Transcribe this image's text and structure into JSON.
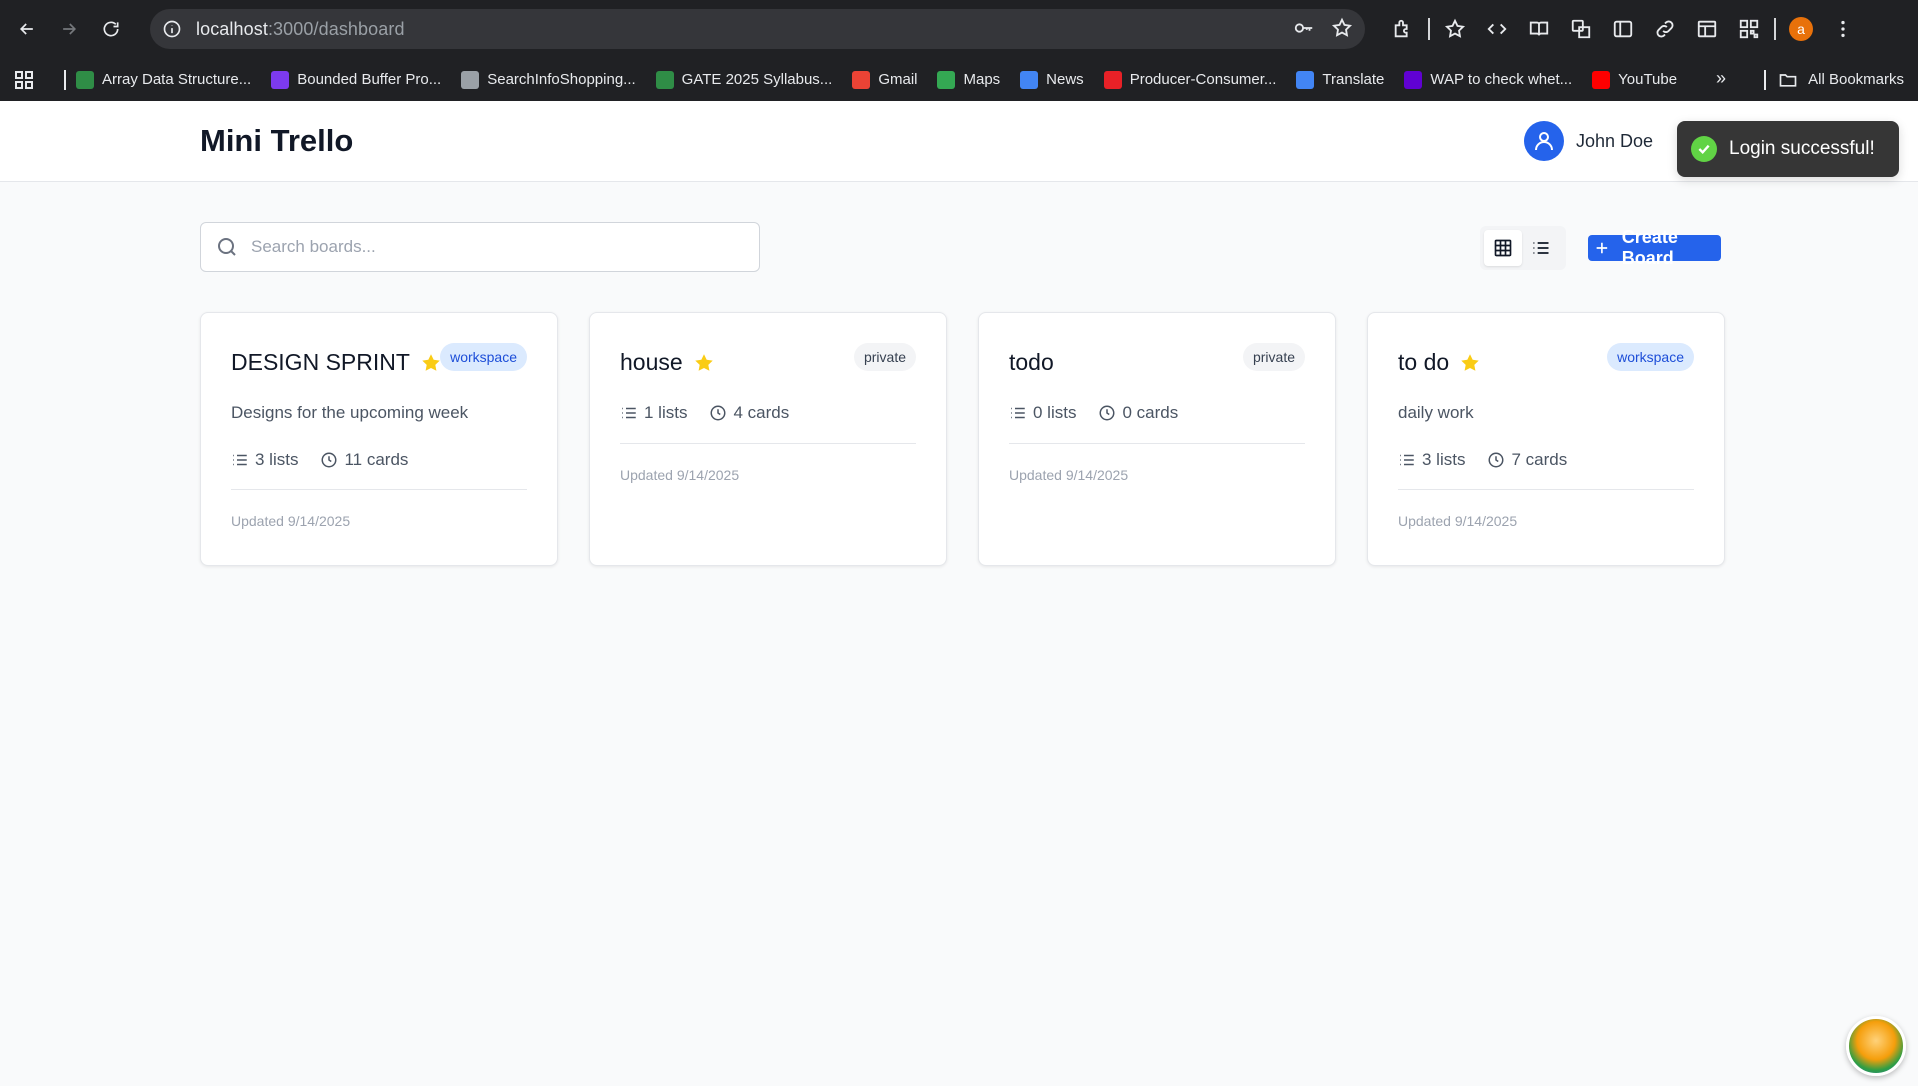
{
  "browser": {
    "url_host": "localhost",
    "url_path": ":3000/dashboard",
    "profile_initial": "a",
    "bookmarks": [
      {
        "label": "Array Data Structure...",
        "icon": "gfg-icon",
        "color": "#2f8d46"
      },
      {
        "label": "Bounded Buffer Pro...",
        "icon": "studytonight-icon",
        "color": "#7c3aed"
      },
      {
        "label": "SearchInfoShopping...",
        "icon": "globe-icon",
        "color": "#9aa0a6"
      },
      {
        "label": "GATE 2025 Syllabus...",
        "icon": "gfg-icon",
        "color": "#2f8d46"
      },
      {
        "label": "Gmail",
        "icon": "gmail-icon",
        "color": "#ea4335"
      },
      {
        "label": "Maps",
        "icon": "maps-icon",
        "color": "#34a853"
      },
      {
        "label": "News",
        "icon": "news-icon",
        "color": "#4285f4"
      },
      {
        "label": "Producer-Consumer...",
        "icon": "tesla-icon",
        "color": "#e82127"
      },
      {
        "label": "Translate",
        "icon": "translate-icon",
        "color": "#4285f4"
      },
      {
        "label": "WAP to check whet...",
        "icon": "yahoo-icon",
        "color": "#6001d2"
      },
      {
        "label": "YouTube",
        "icon": "youtube-icon",
        "color": "#ff0000"
      }
    ],
    "all_bookmarks": "All Bookmarks"
  },
  "app": {
    "title": "Mini Trello",
    "user_name": "John Doe",
    "toast": "Login successful!",
    "search_placeholder": "Search boards...",
    "create_board": "Create Board",
    "accent": "#2563eb"
  },
  "boards": [
    {
      "title": "DESIGN SPRINT",
      "starred": true,
      "visibility": "workspace",
      "description": "Designs for the upcoming week",
      "lists": "3 lists",
      "cards": "11 cards",
      "updated": "Updated 9/14/2025"
    },
    {
      "title": "house",
      "starred": true,
      "visibility": "private",
      "description": "",
      "lists": "1 lists",
      "cards": "4 cards",
      "updated": "Updated 9/14/2025"
    },
    {
      "title": "todo",
      "starred": false,
      "visibility": "private",
      "description": "",
      "lists": "0 lists",
      "cards": "0 cards",
      "updated": "Updated 9/14/2025"
    },
    {
      "title": "to do",
      "starred": true,
      "visibility": "workspace",
      "description": "daily work",
      "lists": "3 lists",
      "cards": "7 cards",
      "updated": "Updated 9/14/2025"
    }
  ]
}
